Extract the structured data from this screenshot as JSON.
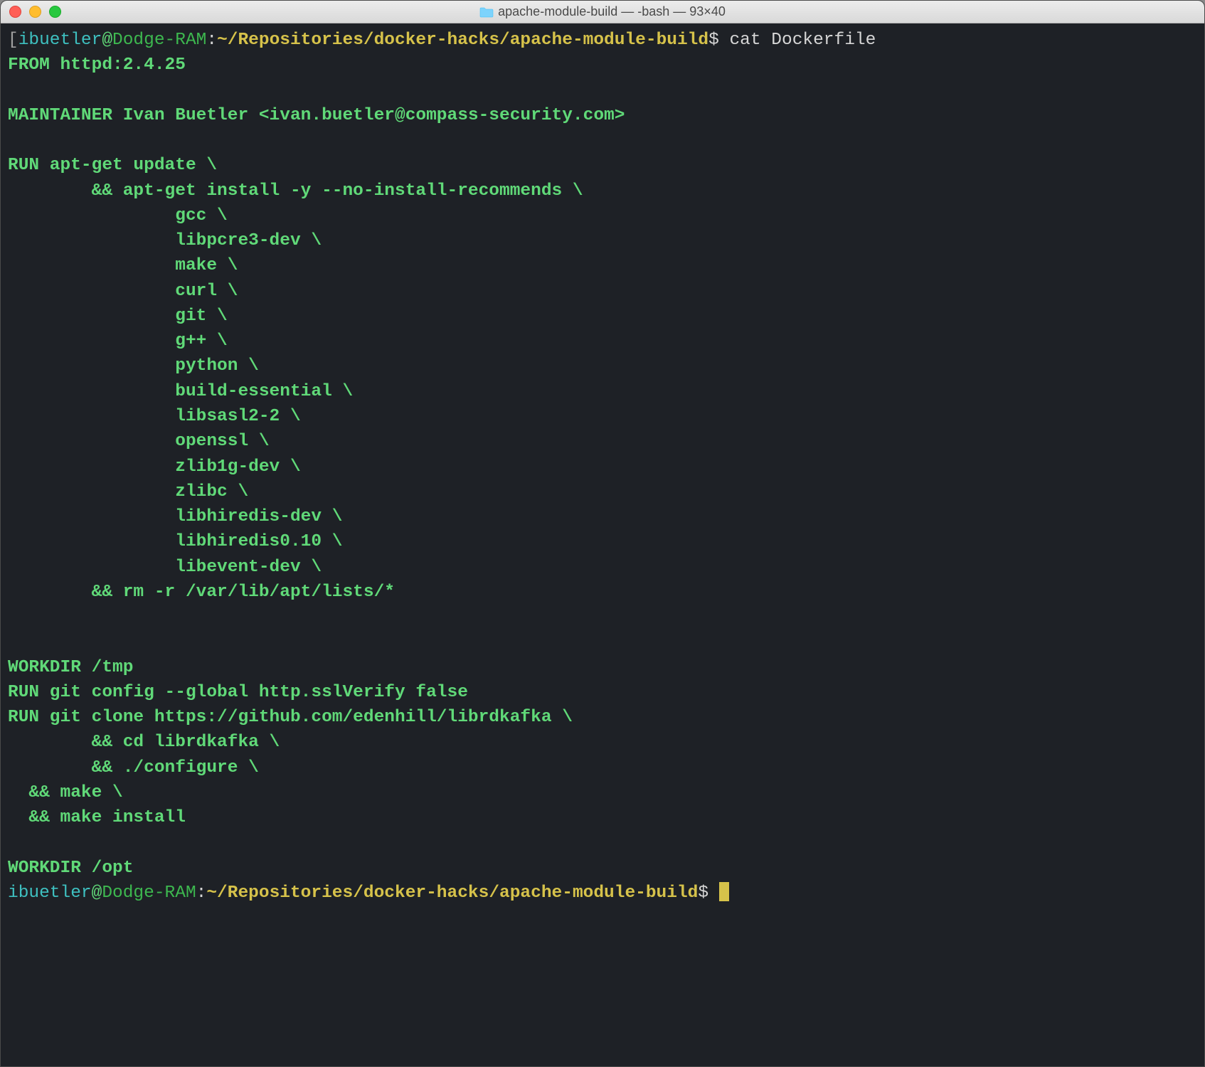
{
  "window": {
    "title": "apache-module-build — -bash — 93×40",
    "traffic_lights": {
      "close": "close",
      "minimize": "minimize",
      "maximize": "maximize"
    },
    "folder_icon_color": "#56c1ff"
  },
  "prompt1": {
    "bracket": "[",
    "user": "ibuetler",
    "at": "@",
    "host": "Dodge-RAM",
    "colon": ":",
    "path": "~/Repositories/docker-hacks/apache-module-build",
    "dollar": "$",
    "command": " cat Dockerfile"
  },
  "output": {
    "l01": "FROM httpd:2.4.25",
    "l02": "",
    "l03": "MAINTAINER Ivan Buetler <ivan.buetler@compass-security.com>",
    "l04": "",
    "l05": "RUN apt-get update \\",
    "l06": "        && apt-get install -y --no-install-recommends \\",
    "l07": "                gcc \\",
    "l08": "                libpcre3-dev \\",
    "l09": "                make \\",
    "l10": "                curl \\",
    "l11": "                git \\",
    "l12": "                g++ \\",
    "l13": "                python \\",
    "l14": "                build-essential \\",
    "l15": "                libsasl2-2 \\",
    "l16": "                openssl \\",
    "l17": "                zlib1g-dev \\",
    "l18": "                zlibc \\",
    "l19": "                libhiredis-dev \\",
    "l20": "                libhiredis0.10 \\",
    "l21": "                libevent-dev \\",
    "l22": "        && rm -r /var/lib/apt/lists/*",
    "l23": "",
    "l24": "",
    "l25": "WORKDIR /tmp",
    "l26": "RUN git config --global http.sslVerify false",
    "l27": "RUN git clone https://github.com/edenhill/librdkafka \\",
    "l28": "        && cd librdkafka \\",
    "l29": "        && ./configure \\",
    "l30": "  && make \\",
    "l31": "  && make install",
    "l32": "",
    "l33": "WORKDIR /opt"
  },
  "prompt2": {
    "user": "ibuetler",
    "at": "@",
    "host": "Dodge-RAM",
    "colon": ":",
    "path": "~/Repositories/docker-hacks/apache-module-build",
    "dollar": "$",
    "space": " "
  }
}
